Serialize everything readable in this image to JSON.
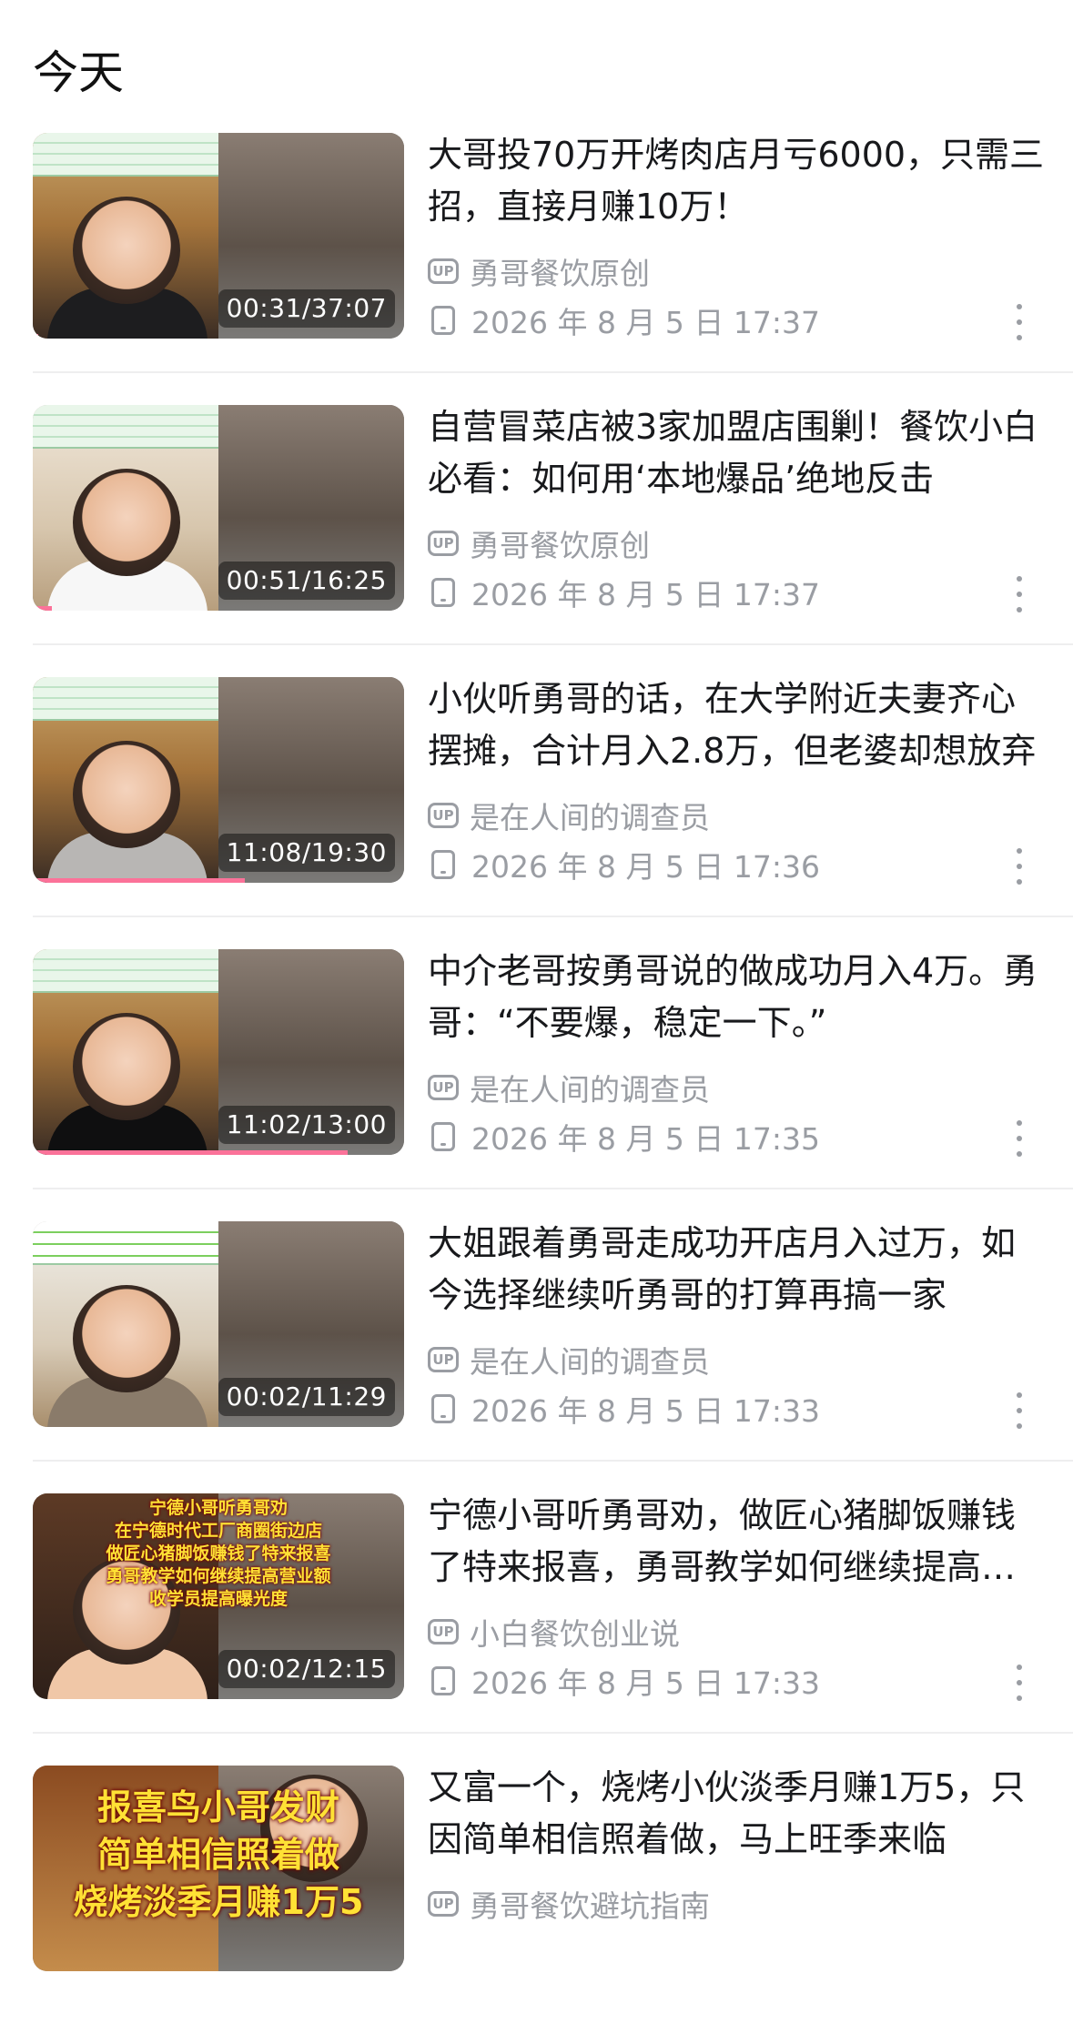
{
  "section": {
    "title": "今天"
  },
  "items": [
    {
      "title": "大哥投70万开烤肉店月亏6000，只需三招，直接月赚10万！",
      "uploader": "勇哥餐饮原创",
      "time": "2026 年 8 月 5 日 17:37",
      "duration": "00:31/37:07",
      "progress_fraction": 0.014
    },
    {
      "title": "自营冒菜店被3家加盟店围剿！餐饮小白必看：如何用‘本地爆品’绝地反击",
      "uploader": "勇哥餐饮原创",
      "time": "2026 年 8 月 5 日 17:37",
      "duration": "00:51/16:25",
      "progress_fraction": 0.052
    },
    {
      "title": "小伙听勇哥的话，在大学附近夫妻齐心摆摊，合计月入2.8万，但老婆却想放弃",
      "uploader": "是在人间的调查员",
      "time": "2026 年 8 月 5 日 17:36",
      "duration": "11:08/19:30",
      "progress_fraction": 0.571
    },
    {
      "title": "中介老哥按勇哥说的做成功月入4万。勇哥：“不要爆，稳定一下。”",
      "uploader": "是在人间的调查员",
      "time": "2026 年 8 月 5 日 17:35",
      "duration": "11:02/13:00",
      "progress_fraction": 0.849
    },
    {
      "title": "大姐跟着勇哥走成功开店月入过万，如今选择继续听勇哥的打算再搞一家",
      "uploader": "是在人间的调查员",
      "time": "2026 年 8 月 5 日 17:33",
      "duration": "00:02/11:29",
      "progress_fraction": 0.003
    },
    {
      "title": "宁德小哥听勇哥劝，做匠心猪脚饭赚钱了特来报喜，勇哥教学如何继续提高营业额",
      "uploader": "小白餐饮创业说",
      "time": "2026 年 8 月 5 日 17:33",
      "duration": "00:02/12:15",
      "progress_fraction": 0.003,
      "thumb_caption": [
        "宁德小哥听勇哥劝",
        "在宁德时代工厂商圈街边店",
        "做匠心猪脚饭赚钱了特来报喜",
        "勇哥教学如何继续提高营业额",
        "收学员提高曝光度"
      ]
    },
    {
      "title": "又富一个，烧烤小伙淡季月赚1万5，只因简单相信照着做，马上旺季来临",
      "uploader": "勇哥餐饮避坑指南",
      "time": "",
      "duration": "",
      "progress_fraction": 0,
      "thumb_caption": [
        "报喜鸟小哥发财",
        "简单相信照着做",
        "烧烤淡季月赚1万5"
      ]
    }
  ],
  "icons": {
    "uploader": "up-badge-icon",
    "time": "device-icon",
    "more": "more-vertical-icon"
  },
  "colors": {
    "accent": "#fb7299",
    "meta_text": "#9a9da3",
    "title_text": "#18191c",
    "caption_text": "#ffe135"
  }
}
